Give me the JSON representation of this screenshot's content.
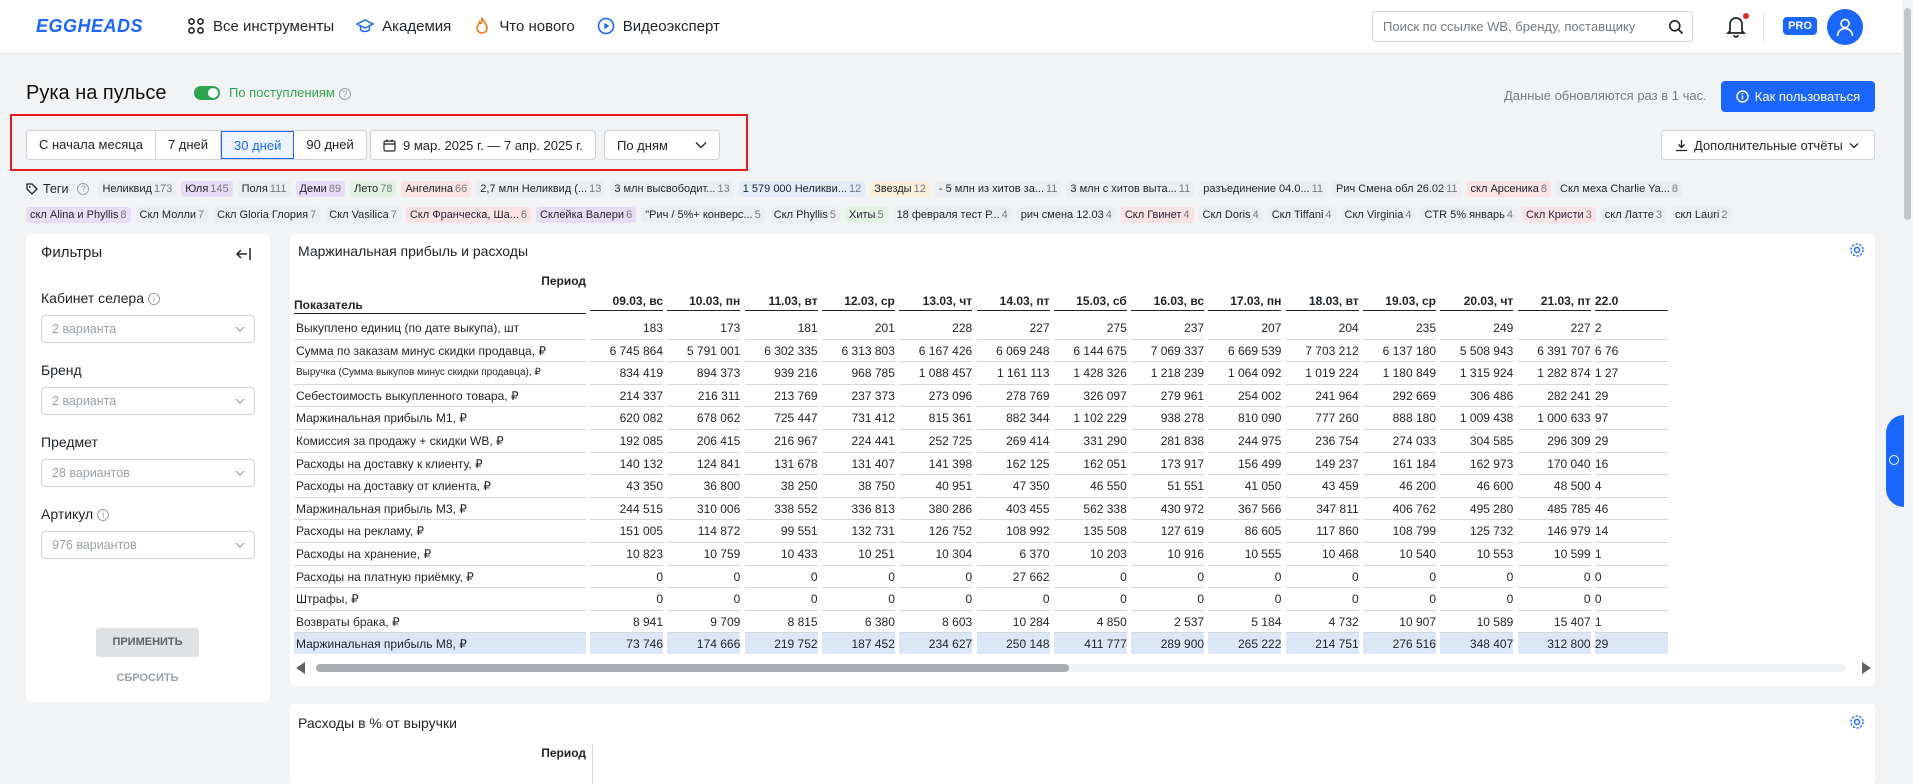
{
  "header": {
    "logo": "EGGHEADS",
    "nav": [
      {
        "label": "Все инструменты",
        "icon": "grid-icon"
      },
      {
        "label": "Академия",
        "icon": "graduation-cap-icon"
      },
      {
        "label": "Что нового",
        "icon": "flame-icon"
      },
      {
        "label": "Видеоэксперт",
        "icon": "play-circle-icon"
      }
    ],
    "search_placeholder": "Поиск по ссылке WB, бренду, поставщику",
    "pro_badge": "PRO"
  },
  "page": {
    "title": "Рука на пульсе",
    "toggle_label": "По поступлениям",
    "toggle_on": true,
    "update_note": "Данные обновляются раз в 1 час.",
    "howto_label": "Как пользоваться",
    "extra_reports_label": "Дополнительные отчёты"
  },
  "period": {
    "buttons": [
      "С начала месяца",
      "7 дней",
      "30 дней",
      "90 дней"
    ],
    "active": "30 дней",
    "date_range": "9 мар. 2025 г. — 7 апр. 2025 г.",
    "granularity": "По дням"
  },
  "tags": {
    "label": "Теги",
    "row1": [
      {
        "name": "Неликвид",
        "count": "173",
        "bg": "#eceef1"
      },
      {
        "name": "Юля",
        "count": "145",
        "bg": "#e8ddf7"
      },
      {
        "name": "Поля",
        "count": "111",
        "bg": "#eceef1"
      },
      {
        "name": "Деми",
        "count": "89",
        "bg": "#e8ddf7"
      },
      {
        "name": "Лето",
        "count": "78",
        "bg": "#e3f3e1"
      },
      {
        "name": "Ангелина",
        "count": "66",
        "bg": "#fbe3e3"
      },
      {
        "name": "2,7 млн Неликвид (...",
        "count": "13",
        "bg": "#eceef1"
      },
      {
        "name": "3 млн высвободит...",
        "count": "13",
        "bg": "#eceef1"
      },
      {
        "name": "1 579 000 Неликви...",
        "count": "12",
        "bg": "#e3ecfa"
      },
      {
        "name": "Звезды",
        "count": "12",
        "bg": "#fbf0d9"
      },
      {
        "name": "- 5 млн из хитов за...",
        "count": "11",
        "bg": "#eceef1"
      },
      {
        "name": "3 млн с хитов выта...",
        "count": "11",
        "bg": "#eceef1"
      },
      {
        "name": "разъединение 04.0...",
        "count": "11",
        "bg": "#eceef1"
      },
      {
        "name": "Рич Смена обл 26.02",
        "count": "11",
        "bg": "#eceef1"
      },
      {
        "name": "скл Арсеника",
        "count": "8",
        "bg": "#fbe3e3"
      },
      {
        "name": "Скл меха Charlie Ya...",
        "count": "8",
        "bg": "#eceef1"
      }
    ],
    "row2": [
      {
        "name": "скл Alina и Phyllis",
        "count": "8",
        "bg": "#e8ddf7"
      },
      {
        "name": "Скл Молли",
        "count": "7",
        "bg": "#eceef1"
      },
      {
        "name": "Скл Gloria Глория",
        "count": "7",
        "bg": "#eceef1"
      },
      {
        "name": "Скл Vasilica",
        "count": "7",
        "bg": "#eceef1"
      },
      {
        "name": "Скл Франческа, Ша...",
        "count": "6",
        "bg": "#fbe3e3"
      },
      {
        "name": "Склейка Валери",
        "count": "6",
        "bg": "#e8ddf7"
      },
      {
        "name": "\"Рич / 5%+ конверс...",
        "count": "5",
        "bg": "#eceef1"
      },
      {
        "name": "Скл Phyllis",
        "count": "5",
        "bg": "#eceef1"
      },
      {
        "name": "Хиты",
        "count": "5",
        "bg": "#e3f3e1"
      },
      {
        "name": "18 февраля тест Р...",
        "count": "4",
        "bg": "#eceef1"
      },
      {
        "name": "рич смена 12.03",
        "count": "4",
        "bg": "#eceef1"
      },
      {
        "name": "Скл Гвинет",
        "count": "4",
        "bg": "#fbe3e3"
      },
      {
        "name": "Скл Doris",
        "count": "4",
        "bg": "#eceef1"
      },
      {
        "name": "Скл Tiffani",
        "count": "4",
        "bg": "#eceef1"
      },
      {
        "name": "Скл Virginia",
        "count": "4",
        "bg": "#eceef1"
      },
      {
        "name": "CTR 5% январь",
        "count": "4",
        "bg": "#eceef1"
      },
      {
        "name": "Скл Кристи",
        "count": "3",
        "bg": "#fbe3e3"
      },
      {
        "name": "скл Латте",
        "count": "3",
        "bg": "#eceef1"
      },
      {
        "name": "скл Lauri",
        "count": "2",
        "bg": "#eceef1"
      }
    ]
  },
  "filters": {
    "title": "Фильтры",
    "fields": [
      {
        "label": "Кабинет селера",
        "value": "2 варианта",
        "info": true
      },
      {
        "label": "Бренд",
        "value": "2 варианта",
        "info": false
      },
      {
        "label": "Предмет",
        "value": "28 вариантов",
        "info": false
      },
      {
        "label": "Артикул",
        "value": "976 вариантов",
        "info": true
      }
    ],
    "apply_label": "ПРИМЕНИТЬ",
    "reset_label": "СБРОСИТЬ"
  },
  "margin_table": {
    "title": "Маржинальная прибыль и расходы",
    "period_header": "Период",
    "indicator_header": "Показатель",
    "rows": [
      "Выкуплено единиц (по дате выкупа), шт",
      "Сумма по заказам минус скидки продавца, ₽",
      "Выручка (Сумма выкупов минус скидки продавца), ₽",
      "Себестоимость выкупленного товара, ₽",
      "Маржинальная прибыль М1, ₽",
      "Комиссия за продажу + скидки WB, ₽",
      "Расходы на доставку к клиенту, ₽",
      "Расходы на доставку от клиента, ₽",
      "Маржинальная прибыль М3, ₽",
      "Расходы на рекламу, ₽",
      "Расходы на хранение, ₽",
      "Расходы на платную приёмку, ₽",
      "Штрафы, ₽",
      "Возвраты брака, ₽",
      "Маржинальная прибыль М8, ₽"
    ],
    "columns": [
      {
        "date": "09.03, вс",
        "values": [
          "183",
          "6 745 864",
          "834 419",
          "214 337",
          "620 082",
          "192 085",
          "140 132",
          "43 350",
          "244 515",
          "151 005",
          "10 823",
          "0",
          "0",
          "8 941",
          "73 746"
        ]
      },
      {
        "date": "10.03, пн",
        "values": [
          "173",
          "5 791 001",
          "894 373",
          "216 311",
          "678 062",
          "206 415",
          "124 841",
          "36 800",
          "310 006",
          "114 872",
          "10 759",
          "0",
          "0",
          "9 709",
          "174 666"
        ]
      },
      {
        "date": "11.03, вт",
        "values": [
          "181",
          "6 302 335",
          "939 216",
          "213 769",
          "725 447",
          "216 967",
          "131 678",
          "38 250",
          "338 552",
          "99 551",
          "10 433",
          "0",
          "0",
          "8 815",
          "219 752"
        ]
      },
      {
        "date": "12.03, ср",
        "values": [
          "201",
          "6 313 803",
          "968 785",
          "237 373",
          "731 412",
          "224 441",
          "131 407",
          "38 750",
          "336 813",
          "132 731",
          "10 251",
          "0",
          "0",
          "6 380",
          "187 452"
        ]
      },
      {
        "date": "13.03, чт",
        "values": [
          "228",
          "6 167 426",
          "1 088 457",
          "273 096",
          "815 361",
          "252 725",
          "141 398",
          "40 951",
          "380 286",
          "126 752",
          "10 304",
          "0",
          "0",
          "8 603",
          "234 627"
        ]
      },
      {
        "date": "14.03, пт",
        "values": [
          "227",
          "6 069 248",
          "1 161 113",
          "278 769",
          "882 344",
          "269 414",
          "162 125",
          "47 350",
          "403 455",
          "108 992",
          "6 370",
          "27 662",
          "0",
          "10 284",
          "250 148"
        ]
      },
      {
        "date": "15.03, сб",
        "values": [
          "275",
          "6 144 675",
          "1 428 326",
          "326 097",
          "1 102 229",
          "331 290",
          "162 051",
          "46 550",
          "562 338",
          "135 508",
          "10 203",
          "0",
          "0",
          "4 850",
          "411 777"
        ]
      },
      {
        "date": "16.03, вс",
        "values": [
          "237",
          "7 069 337",
          "1 218 239",
          "279 961",
          "938 278",
          "281 838",
          "173 917",
          "51 551",
          "430 972",
          "127 619",
          "10 916",
          "0",
          "0",
          "2 537",
          "289 900"
        ]
      },
      {
        "date": "17.03, пн",
        "values": [
          "207",
          "6 669 539",
          "1 064 092",
          "254 002",
          "810 090",
          "244 975",
          "156 499",
          "41 050",
          "367 566",
          "86 605",
          "10 555",
          "0",
          "0",
          "5 184",
          "265 222"
        ]
      },
      {
        "date": "18.03, вт",
        "values": [
          "204",
          "7 703 212",
          "1 019 224",
          "241 964",
          "777 260",
          "236 754",
          "149 237",
          "43 459",
          "347 811",
          "117 860",
          "10 468",
          "0",
          "0",
          "4 732",
          "214 751"
        ]
      },
      {
        "date": "19.03, ср",
        "values": [
          "235",
          "6 137 180",
          "1 180 849",
          "292 669",
          "888 180",
          "274 033",
          "161 184",
          "46 200",
          "406 762",
          "108 799",
          "10 540",
          "0",
          "0",
          "10 907",
          "276 516"
        ]
      },
      {
        "date": "20.03, чт",
        "values": [
          "249",
          "5 508 943",
          "1 315 924",
          "306 486",
          "1 009 438",
          "304 585",
          "162 973",
          "46 600",
          "495 280",
          "125 732",
          "10 553",
          "0",
          "0",
          "10 589",
          "348 407"
        ]
      },
      {
        "date": "21.03, пт",
        "values": [
          "227",
          "6 391 707",
          "1 282 874",
          "282 241",
          "1 000 633",
          "296 309",
          "170 040",
          "48 500",
          "485 785",
          "146 979",
          "10 599",
          "0",
          "0",
          "15 407",
          "312 800"
        ]
      },
      {
        "date": "22.0",
        "values": [
          "2",
          "6 76",
          "1 27",
          "29",
          "97",
          "29",
          "16",
          "4",
          "46",
          "14",
          "1",
          "0",
          "0",
          "1",
          "29"
        ]
      }
    ]
  },
  "expenses_table": {
    "title": "Расходы в % от выручки",
    "period_header": "Период"
  }
}
